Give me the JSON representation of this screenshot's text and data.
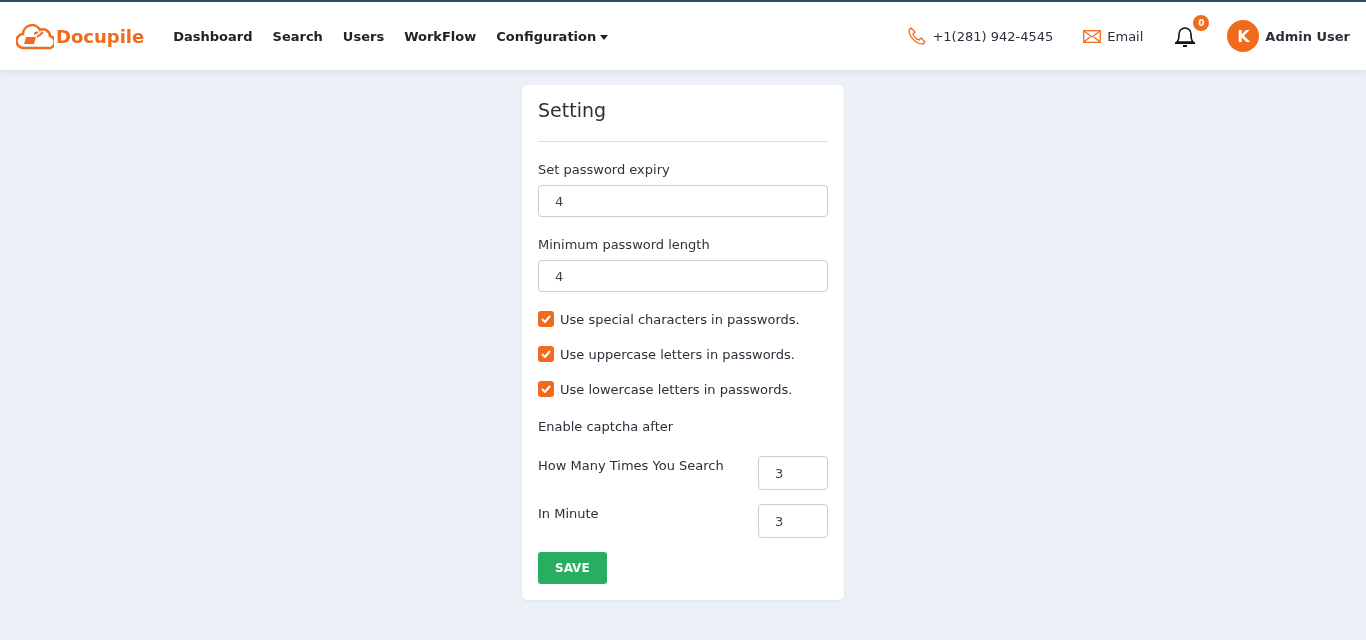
{
  "header": {
    "brand": "Docupile",
    "nav": [
      {
        "label": "Dashboard",
        "kind": "link"
      },
      {
        "label": "Search",
        "kind": "link"
      },
      {
        "label": "Users",
        "kind": "link"
      },
      {
        "label": "WorkFlow",
        "kind": "link"
      },
      {
        "label": "Configuration",
        "kind": "dropdown"
      }
    ],
    "phone": "+1(281) 942-4545",
    "email": "Email",
    "notification_count": "0",
    "avatar_initial": "K",
    "user_name": "Admin User"
  },
  "card": {
    "title": "Setting",
    "fields": [
      {
        "label": "Set password expiry",
        "value": "4"
      },
      {
        "label": "Minimum password length",
        "value": "4"
      }
    ],
    "checkboxes": [
      {
        "label": "Use special characters in passwords.",
        "checked": true
      },
      {
        "label": "Use uppercase letters in passwords.",
        "checked": true
      },
      {
        "label": "Use lowercase letters in passwords.",
        "checked": true
      }
    ],
    "captcha_heading": "Enable captcha after",
    "captcha_fields": [
      {
        "label": "How Many Times You Search",
        "value": "3"
      },
      {
        "label": "In Minute",
        "value": "3"
      }
    ],
    "save_button": "SAVE"
  }
}
